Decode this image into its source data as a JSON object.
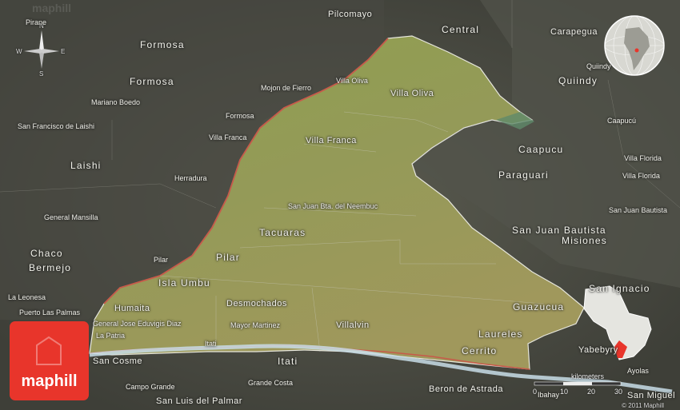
{
  "map": {
    "labels": [
      {
        "id": "pilcomayo",
        "text": "Pilcomayo"
      },
      {
        "id": "central",
        "text": "Central"
      },
      {
        "id": "carapegua",
        "text": "Carapegua"
      },
      {
        "id": "pirane",
        "text": "Pirane"
      },
      {
        "id": "formosa-1",
        "text": "Formosa"
      },
      {
        "id": "formosa-2",
        "text": "Formosa"
      },
      {
        "id": "quiindy-1",
        "text": "Quiindy"
      },
      {
        "id": "quiindy-2",
        "text": "Quiindy"
      },
      {
        "id": "mojon-de-fierro",
        "text": "Mojon de Fierro"
      },
      {
        "id": "villa-oliva-small",
        "text": "Villa Oliva"
      },
      {
        "id": "villa-oliva",
        "text": "Villa Oliva"
      },
      {
        "id": "mariano-boedo",
        "text": "Mariano Boedo"
      },
      {
        "id": "formosa-city",
        "text": "Formosa"
      },
      {
        "id": "san-francisco-de-laishi",
        "text": "San Francisco de Laishi"
      },
      {
        "id": "villa-franca-small",
        "text": "Villa Franca"
      },
      {
        "id": "villa-franca",
        "text": "Villa Franca"
      },
      {
        "id": "caapucu-1",
        "text": "Caapucú"
      },
      {
        "id": "caapucu-2",
        "text": "Caapucu"
      },
      {
        "id": "villa-florida-1",
        "text": "Villa Florida"
      },
      {
        "id": "villa-florida-2",
        "text": "Villa Florida"
      },
      {
        "id": "laishi",
        "text": "Laishi"
      },
      {
        "id": "herradura",
        "text": "Herradura"
      },
      {
        "id": "paraguari",
        "text": "Paraguari"
      },
      {
        "id": "san-juan-bta-del-neembuc",
        "text": "San Juan Bta. del Neembuc"
      },
      {
        "id": "san-juan-bautista-small",
        "text": "San Juan Bautista"
      },
      {
        "id": "general-mansilla",
        "text": "General Mansilla"
      },
      {
        "id": "tacuaras",
        "text": "Tacuaras"
      },
      {
        "id": "san-juan-bautista-misiones",
        "text": "San Juan Bautista"
      },
      {
        "id": "misiones",
        "text": "Misiones"
      },
      {
        "id": "chaco",
        "text": "Chaco"
      },
      {
        "id": "bermejo",
        "text": "Bermejo"
      },
      {
        "id": "pilar-small",
        "text": "Pilar"
      },
      {
        "id": "pilar",
        "text": "Pilar"
      },
      {
        "id": "isla-umbu",
        "text": "Isla Umbu"
      },
      {
        "id": "san-ignacio",
        "text": "San Ignacio"
      },
      {
        "id": "la-leonesa",
        "text": "La Leonesa"
      },
      {
        "id": "humaita",
        "text": "Humaita"
      },
      {
        "id": "desmochados",
        "text": "Desmochados"
      },
      {
        "id": "guazucua",
        "text": "Guazucua"
      },
      {
        "id": "puerto-las-palmas",
        "text": "Puerto Las Palmas"
      },
      {
        "id": "general-jose-eduvigis-diaz",
        "text": "General Jose Eduvigis Diaz"
      },
      {
        "id": "mayor-martinez",
        "text": "Mayor Martinez"
      },
      {
        "id": "villalvin",
        "text": "Villalvin"
      },
      {
        "id": "laureles",
        "text": "Laureles"
      },
      {
        "id": "la-patria",
        "text": "La Patria"
      },
      {
        "id": "itati-small",
        "text": "Itati"
      },
      {
        "id": "cerrito",
        "text": "Cerrito"
      },
      {
        "id": "yabebyry",
        "text": "Yabebyry"
      },
      {
        "id": "san-cosme",
        "text": "San Cosme"
      },
      {
        "id": "itati",
        "text": "Itati"
      },
      {
        "id": "ayolas",
        "text": "Ayolas"
      },
      {
        "id": "campo-grande",
        "text": "Campo Grande"
      },
      {
        "id": "grande-costa",
        "text": "Grande Costa"
      },
      {
        "id": "beron-de-astrada",
        "text": "Beron de Astrada"
      },
      {
        "id": "ibahay",
        "text": "Ibahay"
      },
      {
        "id": "san-luis-del-palmar",
        "text": "San Luis del Palmar"
      },
      {
        "id": "san-miguel",
        "text": "San Miguel"
      }
    ]
  },
  "compass": {
    "n": "N",
    "s": "S",
    "e": "E",
    "w": "W"
  },
  "scale": {
    "unit": "kilometers",
    "ticks": [
      "0",
      "10",
      "20",
      "30"
    ]
  },
  "logo": {
    "text": "maphill"
  },
  "watermark": "maphill",
  "copyright": "© 2011 Maphill",
  "colors": {
    "highlight": "#e8352b",
    "region": "#8f9a52",
    "surrounding": "#4b4c44"
  }
}
